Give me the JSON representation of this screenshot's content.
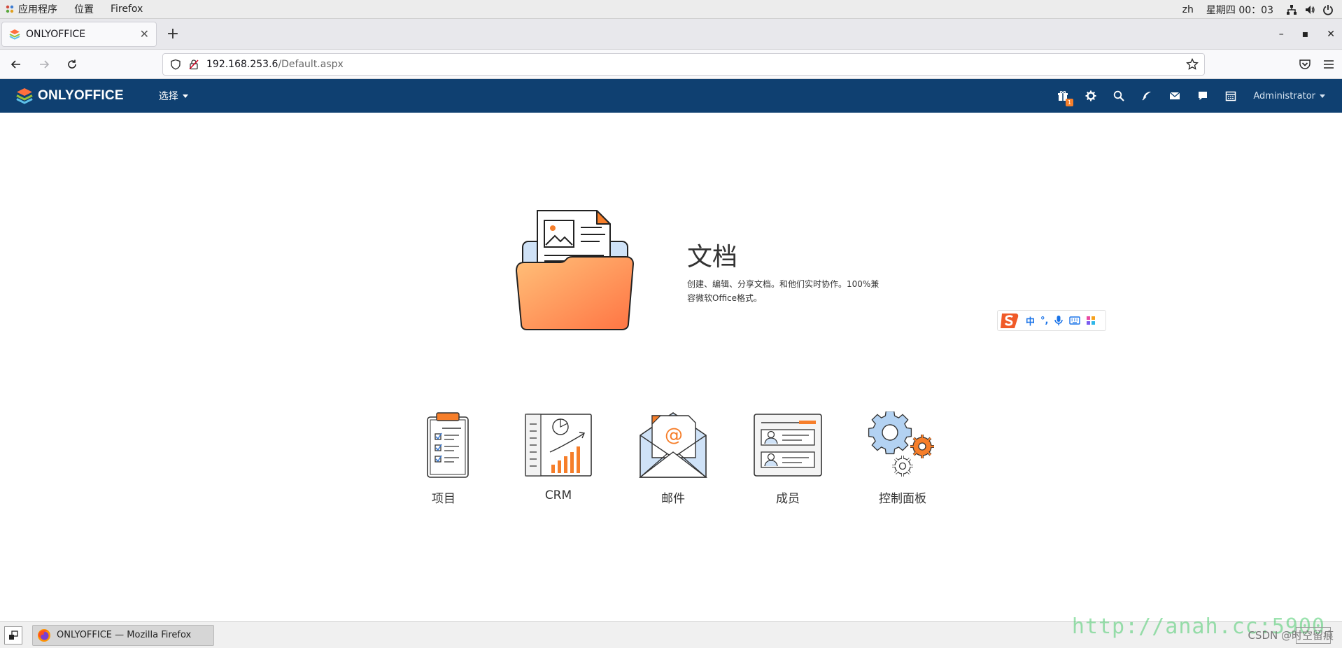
{
  "system_bar": {
    "apps_label": "应用程序",
    "places_label": "位置",
    "active_app": "Firefox",
    "lang": "zh",
    "clock": "星期四 00：03"
  },
  "browser": {
    "tab_title": "ONLYOFFICE",
    "url_host": "192.168.253.6",
    "url_path": "/Default.aspx"
  },
  "oo_header": {
    "brand": "ONLYOFFICE",
    "select_label": "选择",
    "gift_badge": "1",
    "user": "Administrator"
  },
  "hero": {
    "title": "文档",
    "description": "创建、编辑、分享文档。和他们实时协作。100%兼容微软Office格式。"
  },
  "ime": {
    "mode": "中",
    "punct": "°,"
  },
  "modules": [
    {
      "label": "项目"
    },
    {
      "label": "CRM"
    },
    {
      "label": "邮件"
    },
    {
      "label": "成员"
    },
    {
      "label": "控制面板"
    }
  ],
  "taskbar": {
    "window_title": "ONLYOFFICE — Mozilla Firefox"
  },
  "watermark": "http://anah.cc:5900",
  "csdn_label": "CSDN @时空留痕",
  "colors": {
    "header_bg": "#0f4071",
    "accent_orange": "#f67e2a",
    "folder_light": "#ffb36b",
    "folder_dark": "#ff7b4a"
  }
}
